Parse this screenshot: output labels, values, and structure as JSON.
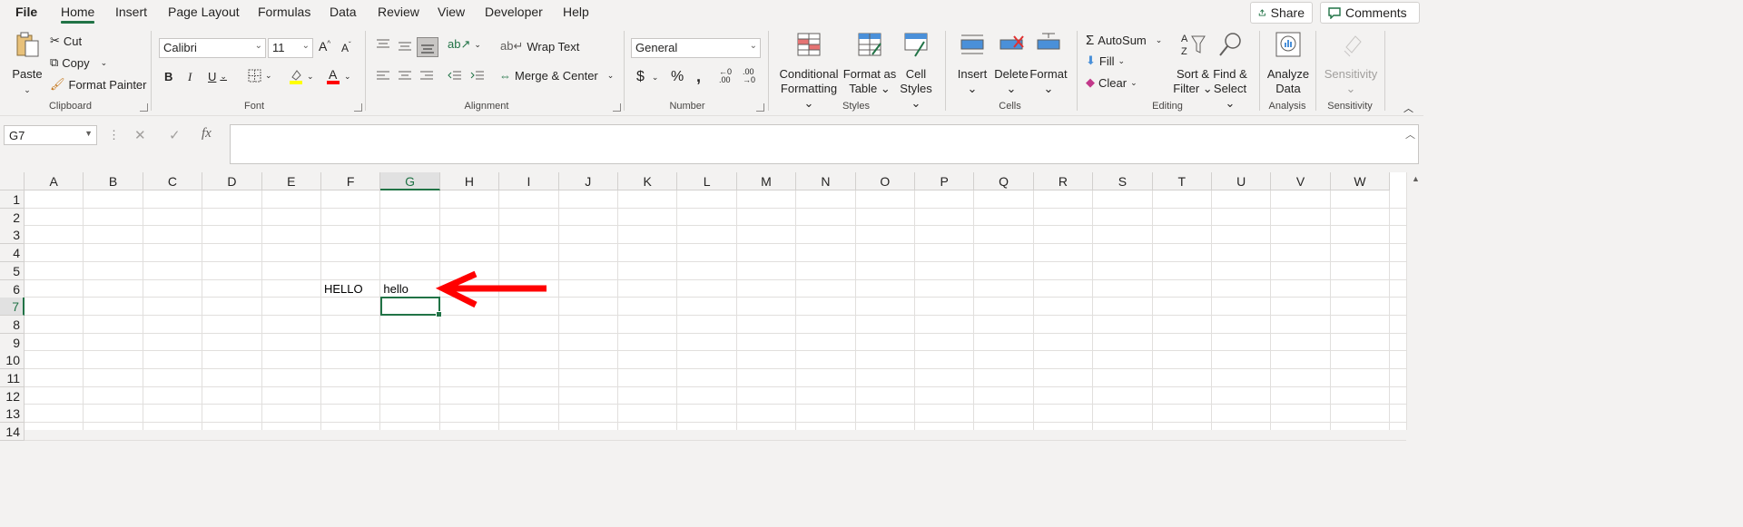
{
  "tabs": {
    "file": "File",
    "home": "Home",
    "insert": "Insert",
    "page_layout": "Page Layout",
    "formulas": "Formulas",
    "data": "Data",
    "review": "Review",
    "view": "View",
    "developer": "Developer",
    "help": "Help"
  },
  "top_buttons": {
    "share": "Share",
    "comments": "Comments"
  },
  "clipboard": {
    "paste": "Paste",
    "cut": "Cut",
    "copy": "Copy",
    "format_painter": "Format Painter",
    "label": "Clipboard"
  },
  "font": {
    "name": "Calibri",
    "size": "11",
    "label": "Font"
  },
  "alignment": {
    "wrap_text": "Wrap Text",
    "merge_center": "Merge & Center",
    "label": "Alignment"
  },
  "number": {
    "format": "General",
    "label": "Number"
  },
  "styles": {
    "conditional_1": "Conditional",
    "conditional_2": "Formatting",
    "format_table_1": "Format as",
    "format_table_2": "Table",
    "cell_styles_1": "Cell",
    "cell_styles_2": "Styles",
    "label": "Styles"
  },
  "cells": {
    "insert": "Insert",
    "delete": "Delete",
    "format": "Format",
    "label": "Cells"
  },
  "editing": {
    "autosum": "AutoSum",
    "fill": "Fill",
    "clear": "Clear",
    "sort_1": "Sort &",
    "sort_2": "Filter",
    "find_1": "Find &",
    "find_2": "Select",
    "label": "Editing"
  },
  "analysis": {
    "analyze_1": "Analyze",
    "analyze_2": "Data",
    "label": "Analysis"
  },
  "sensitivity": {
    "button": "Sensitivity",
    "label": "Sensitivity"
  },
  "formula_bar": {
    "name_box": "G7",
    "fx": "fx",
    "value": ""
  },
  "sheet": {
    "columns": [
      "A",
      "B",
      "C",
      "D",
      "E",
      "F",
      "G",
      "H",
      "I",
      "J",
      "K",
      "L",
      "M",
      "N",
      "O",
      "P",
      "Q",
      "R",
      "S",
      "T",
      "U",
      "V",
      "W"
    ],
    "rows": [
      "1",
      "2",
      "3",
      "4",
      "5",
      "6",
      "7",
      "8",
      "9",
      "10",
      "11",
      "12",
      "13",
      "14"
    ],
    "selected_column": "G",
    "selected_row": "7",
    "cells": {
      "F6": "HELLO",
      "G6": "hello"
    }
  },
  "colors": {
    "accent": "#217346",
    "arrow": "#ff0000"
  }
}
